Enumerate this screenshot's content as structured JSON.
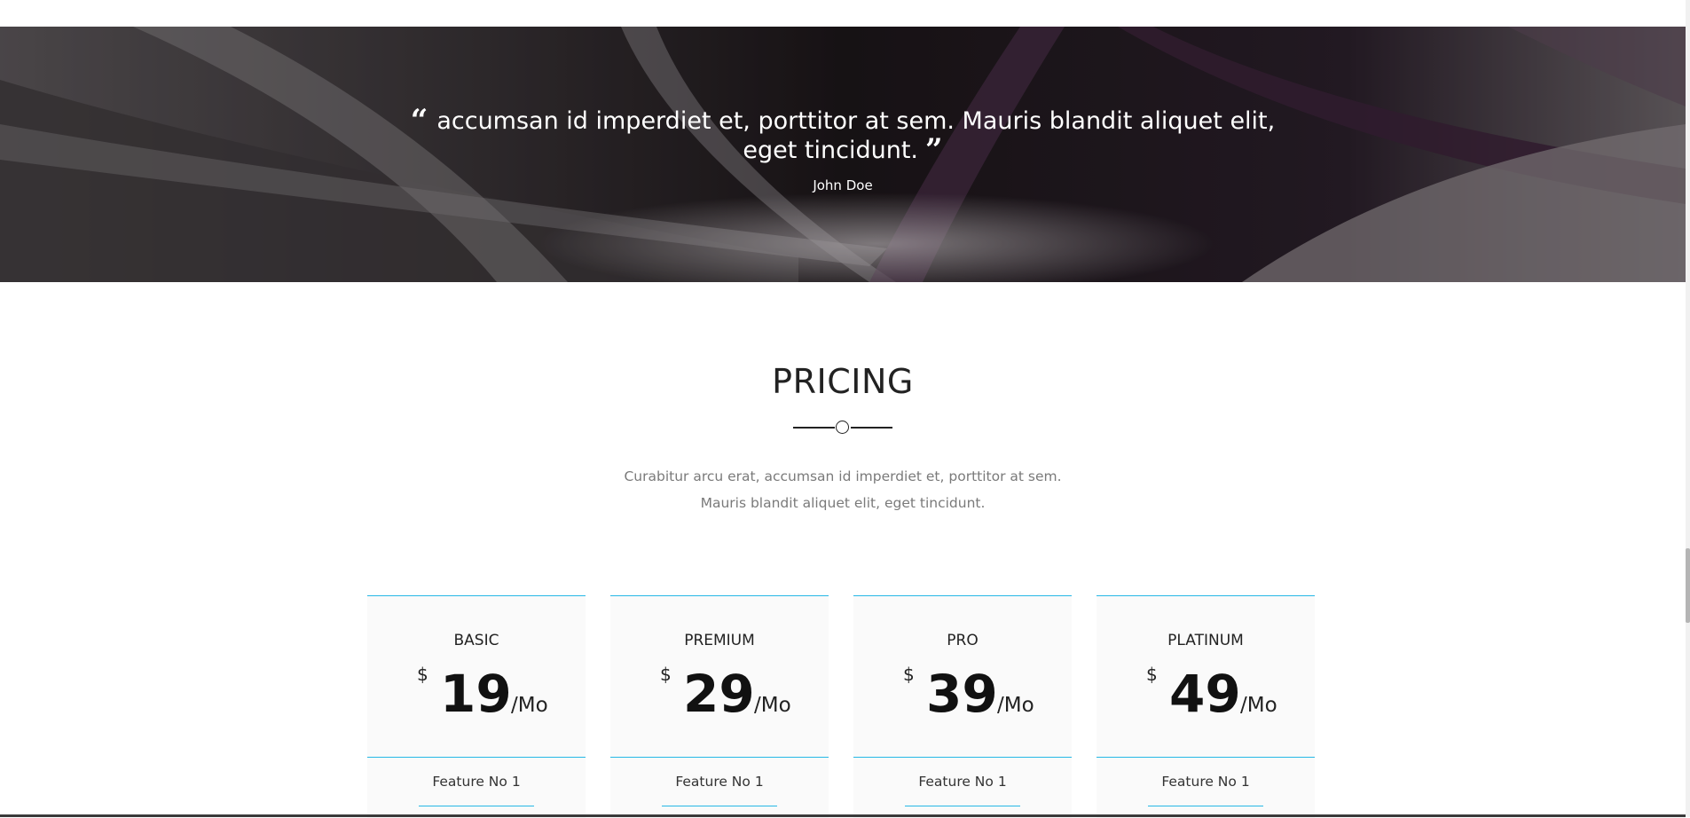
{
  "testimonial": {
    "quote": "accumsan id imperdiet et, porttitor at sem. Mauris blandit aliquet elit, eget tincidunt.",
    "author": "John Doe",
    "open_quote_icon": "quote-left-icon",
    "close_quote_icon": "quote-right-icon"
  },
  "pricing": {
    "title": "PRICING",
    "description": "Curabitur arcu erat, accumsan id imperdiet et, porttitor at sem. Mauris blandit aliquet elit, eget tincidunt.",
    "accent_color": "#27b8e6",
    "plans": [
      {
        "name": "BASIC",
        "currency": "$",
        "amount": "19",
        "period": "/Mo",
        "feature": "Feature No 1"
      },
      {
        "name": "PREMIUM",
        "currency": "$",
        "amount": "29",
        "period": "/Mo",
        "feature": "Feature No 1"
      },
      {
        "name": "PRO",
        "currency": "$",
        "amount": "39",
        "period": "/Mo",
        "feature": "Feature No 1"
      },
      {
        "name": "PLATINUM",
        "currency": "$",
        "amount": "49",
        "period": "/Mo",
        "feature": "Feature No 1"
      }
    ]
  }
}
